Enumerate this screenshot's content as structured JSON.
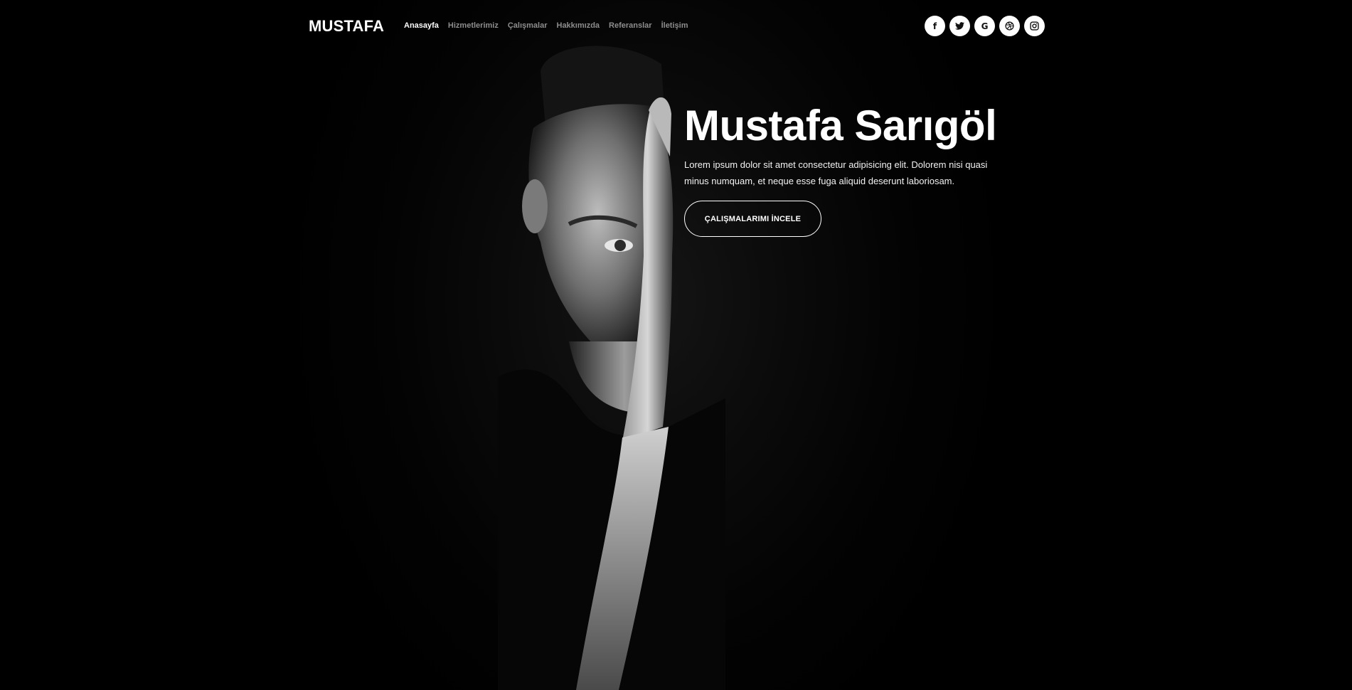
{
  "brand": {
    "logo_text": "MUSTAFA"
  },
  "nav": {
    "items": [
      {
        "label": "Anasayfa",
        "active": true
      },
      {
        "label": "Hizmetlerimiz",
        "active": false
      },
      {
        "label": "Çalışmalar",
        "active": false
      },
      {
        "label": "Hakkımızda",
        "active": false
      },
      {
        "label": "Referanslar",
        "active": false
      },
      {
        "label": "İletişim",
        "active": false
      }
    ]
  },
  "social": [
    {
      "icon": "facebook-icon",
      "glyph": "f"
    },
    {
      "icon": "twitter-icon",
      "glyph": "🐦"
    },
    {
      "icon": "google-icon",
      "glyph": "G"
    },
    {
      "icon": "dribbble-icon",
      "glyph": "⊛"
    },
    {
      "icon": "instagram-icon",
      "glyph": "◎"
    }
  ],
  "hero": {
    "title": "Mustafa Sarıgöl",
    "description": "Lorem ipsum dolor sit amet consectetur adipisicing elit. Dolorem nisi quasi minus numquam, et neque esse fuga aliquid deserunt laboriosam.",
    "cta_label": "ÇALIŞMALARIMI İNCELE"
  },
  "colors": {
    "background": "#000000",
    "text": "#ffffff",
    "menu_inactive": "#8d8d8d"
  }
}
